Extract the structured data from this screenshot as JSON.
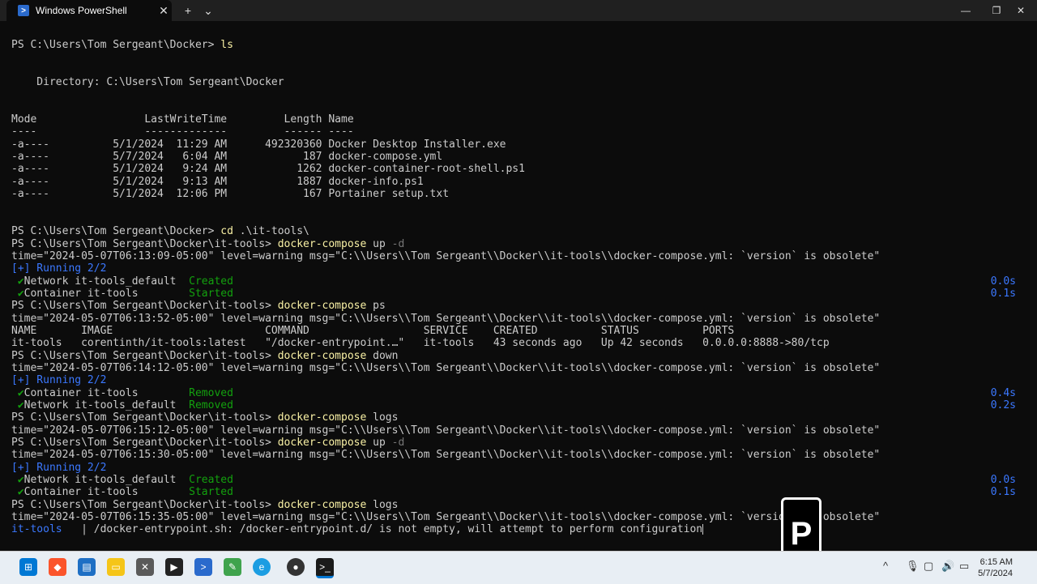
{
  "window": {
    "tab_title": "Windows PowerShell",
    "tab_icon": "powershell-icon",
    "new_tab": "+",
    "dropdown": "⌄",
    "close_tab": "✕",
    "minimize": "—",
    "maximize": "❐",
    "close": "✕"
  },
  "terminal": {
    "prompt_home": "PS C:\\Users\\Tom Sergeant\\Docker> ",
    "prompt_it": "PS C:\\Users\\Tom Sergeant\\Docker\\it-tools> ",
    "cmd_ls": "ls",
    "directory_line": "    Directory: C:\\Users\\Tom Sergeant\\Docker",
    "header": "Mode                 LastWriteTime         Length Name",
    "header_sep": "----                 -------------         ------ ----",
    "files": [
      "-a----          5/1/2024  11:29 AM      492320360 Docker Desktop Installer.exe",
      "-a----          5/7/2024   6:04 AM            187 docker-compose.yml",
      "-a----          5/1/2024   9:24 AM           1262 docker-container-root-shell.ps1",
      "-a----          5/1/2024   9:13 AM           1887 docker-info.ps1",
      "-a----          5/1/2024  12:06 PM            167 Portainer setup.txt"
    ],
    "cmd_cd": "cd",
    "cd_arg": " .\\it-tools\\",
    "dc": "docker-compose",
    "up": " up",
    "up_flag": " -d",
    "ps": " ps",
    "down": " down",
    "logs": " logs",
    "warn_1": "time=\"2024-05-07T06:13:09-05:00\" level=warning msg=\"C:\\\\Users\\\\Tom Sergeant\\\\Docker\\\\it-tools\\\\docker-compose.yml: `version` is obsolete\"",
    "warn_2": "time=\"2024-05-07T06:13:52-05:00\" level=warning msg=\"C:\\\\Users\\\\Tom Sergeant\\\\Docker\\\\it-tools\\\\docker-compose.yml: `version` is obsolete\"",
    "warn_3": "time=\"2024-05-07T06:14:12-05:00\" level=warning msg=\"C:\\\\Users\\\\Tom Sergeant\\\\Docker\\\\it-tools\\\\docker-compose.yml: `version` is obsolete\"",
    "warn_4": "time=\"2024-05-07T06:15:12-05:00\" level=warning msg=\"C:\\\\Users\\\\Tom Sergeant\\\\Docker\\\\it-tools\\\\docker-compose.yml: `version` is obsolete\"",
    "warn_5": "time=\"2024-05-07T06:15:30-05:00\" level=warning msg=\"C:\\\\Users\\\\Tom Sergeant\\\\Docker\\\\it-tools\\\\docker-compose.yml: `version` is obsolete\"",
    "warn_6": "time=\"2024-05-07T06:15:35-05:00\" level=warning msg=\"C:\\\\Users\\\\Tom Sergeant\\\\Docker\\\\it-tools\\\\docker-compose.yml: `version` is obsolete\"",
    "running": "[+] Running 2/2",
    "check": " ✔",
    "net_default": "Network it-tools_default  ",
    "container": "Container it-tools        ",
    "created": "Created",
    "started": "Started",
    "removed": "Removed",
    "dur_00": "0.0s",
    "dur_01": "0.1s",
    "dur_04": "0.4s",
    "dur_02": "0.2s",
    "ps_header": "NAME       IMAGE                        COMMAND                  SERVICE    CREATED          STATUS          PORTS",
    "ps_row": "it-tools   corentinth/it-tools:latest   \"/docker-entrypoint.…\"   it-tools   43 seconds ago   Up 42 seconds   0.0.0.0:8888->80/tcp",
    "log_prefix": "it-tools  ",
    "log_msg": " | /docker-entrypoint.sh: /docker-entrypoint.d/ is not empty, will attempt to perform configuration"
  },
  "taskbar": {
    "apps": [
      "windows-start-icon",
      "brave-browser-icon",
      "news-icon",
      "file-explorer-icon",
      "xbox-icon",
      "terminal-icon",
      "powershell-icon",
      "notepad-icon",
      "edge-icon",
      "obs-icon",
      "powershell-active-icon"
    ],
    "tray_up": "^",
    "time": "6:15 AM",
    "date": "5/7/2024"
  },
  "watermark": {
    "logo_glyph": "P"
  }
}
